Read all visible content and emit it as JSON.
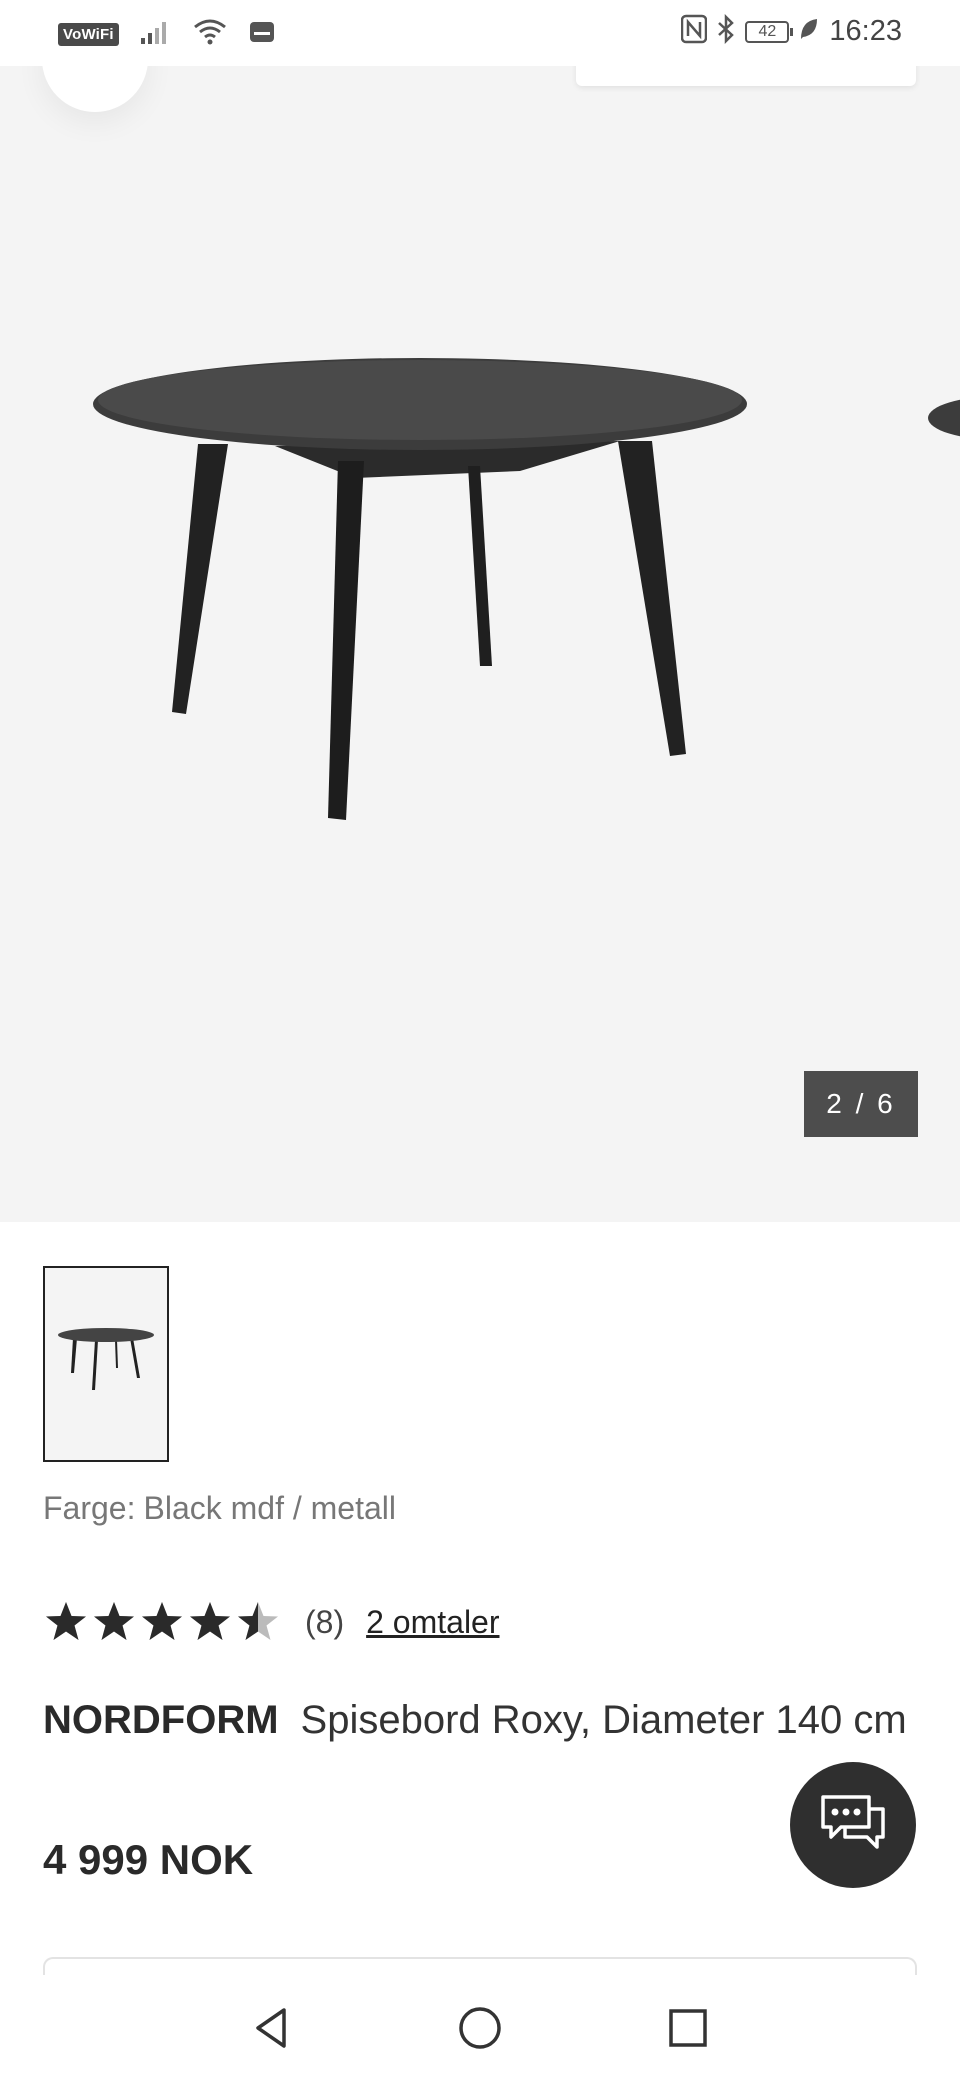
{
  "status_bar": {
    "vowifi_label": "VoWiFi",
    "time": "16:23",
    "battery": "42",
    "icons": [
      "signal-icon",
      "wifi-icon",
      "sim-icon",
      "nfc-icon",
      "bluetooth-icon",
      "battery-icon",
      "leaf-icon"
    ]
  },
  "gallery": {
    "counter": "2 / 6",
    "current_index": 2,
    "total": 6
  },
  "product": {
    "color_label": "Farge:",
    "color_value": "Black mdf / metall",
    "rating_value": 4.5,
    "rating_max": 5,
    "rating_count": "(8)",
    "reviews_link": "2 omtaler",
    "brand": "NORDFORM",
    "name": "Spisebord Roxy, Diameter 140 cm",
    "price": "4 999 NOK"
  },
  "colors": {
    "hero_bg": "#f4f4f4",
    "table": "#3a3a3a",
    "counter_bg": "#4d4d4d",
    "chat_bg": "#2f2f2f",
    "star": "#2a2a2a",
    "star_empty": "#bbbbbb"
  },
  "nav": {
    "icons": [
      "back-icon",
      "home-icon",
      "recents-icon"
    ]
  }
}
